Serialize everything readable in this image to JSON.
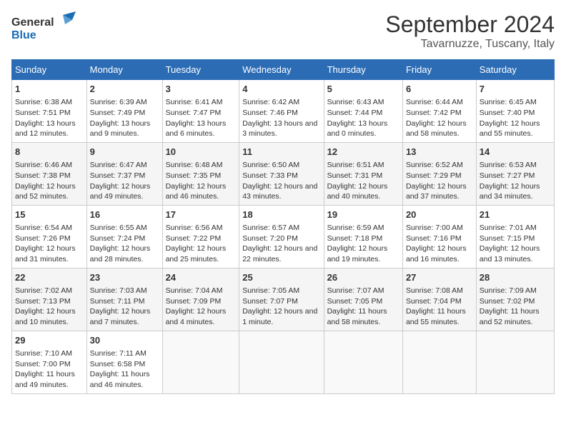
{
  "header": {
    "logo_general": "General",
    "logo_blue": "Blue",
    "month_title": "September 2024",
    "location": "Tavarnuzze, Tuscany, Italy"
  },
  "days_of_week": [
    "Sunday",
    "Monday",
    "Tuesday",
    "Wednesday",
    "Thursday",
    "Friday",
    "Saturday"
  ],
  "weeks": [
    [
      {
        "day": "1",
        "sunrise": "6:38 AM",
        "sunset": "7:51 PM",
        "daylight": "13 hours and 12 minutes."
      },
      {
        "day": "2",
        "sunrise": "6:39 AM",
        "sunset": "7:49 PM",
        "daylight": "13 hours and 9 minutes."
      },
      {
        "day": "3",
        "sunrise": "6:41 AM",
        "sunset": "7:47 PM",
        "daylight": "13 hours and 6 minutes."
      },
      {
        "day": "4",
        "sunrise": "6:42 AM",
        "sunset": "7:46 PM",
        "daylight": "13 hours and 3 minutes."
      },
      {
        "day": "5",
        "sunrise": "6:43 AM",
        "sunset": "7:44 PM",
        "daylight": "13 hours and 0 minutes."
      },
      {
        "day": "6",
        "sunrise": "6:44 AM",
        "sunset": "7:42 PM",
        "daylight": "12 hours and 58 minutes."
      },
      {
        "day": "7",
        "sunrise": "6:45 AM",
        "sunset": "7:40 PM",
        "daylight": "12 hours and 55 minutes."
      }
    ],
    [
      {
        "day": "8",
        "sunrise": "6:46 AM",
        "sunset": "7:38 PM",
        "daylight": "12 hours and 52 minutes."
      },
      {
        "day": "9",
        "sunrise": "6:47 AM",
        "sunset": "7:37 PM",
        "daylight": "12 hours and 49 minutes."
      },
      {
        "day": "10",
        "sunrise": "6:48 AM",
        "sunset": "7:35 PM",
        "daylight": "12 hours and 46 minutes."
      },
      {
        "day": "11",
        "sunrise": "6:50 AM",
        "sunset": "7:33 PM",
        "daylight": "12 hours and 43 minutes."
      },
      {
        "day": "12",
        "sunrise": "6:51 AM",
        "sunset": "7:31 PM",
        "daylight": "12 hours and 40 minutes."
      },
      {
        "day": "13",
        "sunrise": "6:52 AM",
        "sunset": "7:29 PM",
        "daylight": "12 hours and 37 minutes."
      },
      {
        "day": "14",
        "sunrise": "6:53 AM",
        "sunset": "7:27 PM",
        "daylight": "12 hours and 34 minutes."
      }
    ],
    [
      {
        "day": "15",
        "sunrise": "6:54 AM",
        "sunset": "7:26 PM",
        "daylight": "12 hours and 31 minutes."
      },
      {
        "day": "16",
        "sunrise": "6:55 AM",
        "sunset": "7:24 PM",
        "daylight": "12 hours and 28 minutes."
      },
      {
        "day": "17",
        "sunrise": "6:56 AM",
        "sunset": "7:22 PM",
        "daylight": "12 hours and 25 minutes."
      },
      {
        "day": "18",
        "sunrise": "6:57 AM",
        "sunset": "7:20 PM",
        "daylight": "12 hours and 22 minutes."
      },
      {
        "day": "19",
        "sunrise": "6:59 AM",
        "sunset": "7:18 PM",
        "daylight": "12 hours and 19 minutes."
      },
      {
        "day": "20",
        "sunrise": "7:00 AM",
        "sunset": "7:16 PM",
        "daylight": "12 hours and 16 minutes."
      },
      {
        "day": "21",
        "sunrise": "7:01 AM",
        "sunset": "7:15 PM",
        "daylight": "12 hours and 13 minutes."
      }
    ],
    [
      {
        "day": "22",
        "sunrise": "7:02 AM",
        "sunset": "7:13 PM",
        "daylight": "12 hours and 10 minutes."
      },
      {
        "day": "23",
        "sunrise": "7:03 AM",
        "sunset": "7:11 PM",
        "daylight": "12 hours and 7 minutes."
      },
      {
        "day": "24",
        "sunrise": "7:04 AM",
        "sunset": "7:09 PM",
        "daylight": "12 hours and 4 minutes."
      },
      {
        "day": "25",
        "sunrise": "7:05 AM",
        "sunset": "7:07 PM",
        "daylight": "12 hours and 1 minute."
      },
      {
        "day": "26",
        "sunrise": "7:07 AM",
        "sunset": "7:05 PM",
        "daylight": "11 hours and 58 minutes."
      },
      {
        "day": "27",
        "sunrise": "7:08 AM",
        "sunset": "7:04 PM",
        "daylight": "11 hours and 55 minutes."
      },
      {
        "day": "28",
        "sunrise": "7:09 AM",
        "sunset": "7:02 PM",
        "daylight": "11 hours and 52 minutes."
      }
    ],
    [
      {
        "day": "29",
        "sunrise": "7:10 AM",
        "sunset": "7:00 PM",
        "daylight": "11 hours and 49 minutes."
      },
      {
        "day": "30",
        "sunrise": "7:11 AM",
        "sunset": "6:58 PM",
        "daylight": "11 hours and 46 minutes."
      },
      null,
      null,
      null,
      null,
      null
    ]
  ],
  "labels": {
    "sunrise_prefix": "Sunrise: ",
    "sunset_prefix": "Sunset: ",
    "daylight_prefix": "Daylight: "
  }
}
